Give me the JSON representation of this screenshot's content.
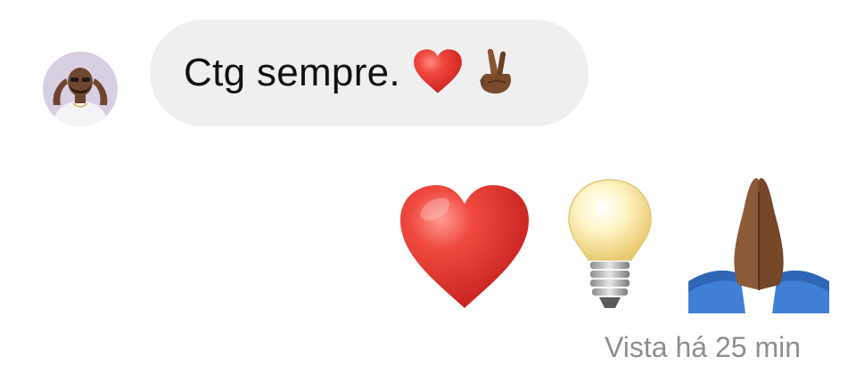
{
  "incoming_message": {
    "text": "Ctg sempre.",
    "emojis": [
      "red-heart",
      "crossed-fingers"
    ]
  },
  "outgoing_message": {
    "emojis": [
      "red-heart",
      "light-bulb",
      "folded-hands"
    ]
  },
  "seen_status": "Vista há 25 min",
  "colors": {
    "bubble_incoming": "#efefef",
    "text": "#111111",
    "status_text": "#8e8e8e",
    "heart": "#e0322d"
  }
}
